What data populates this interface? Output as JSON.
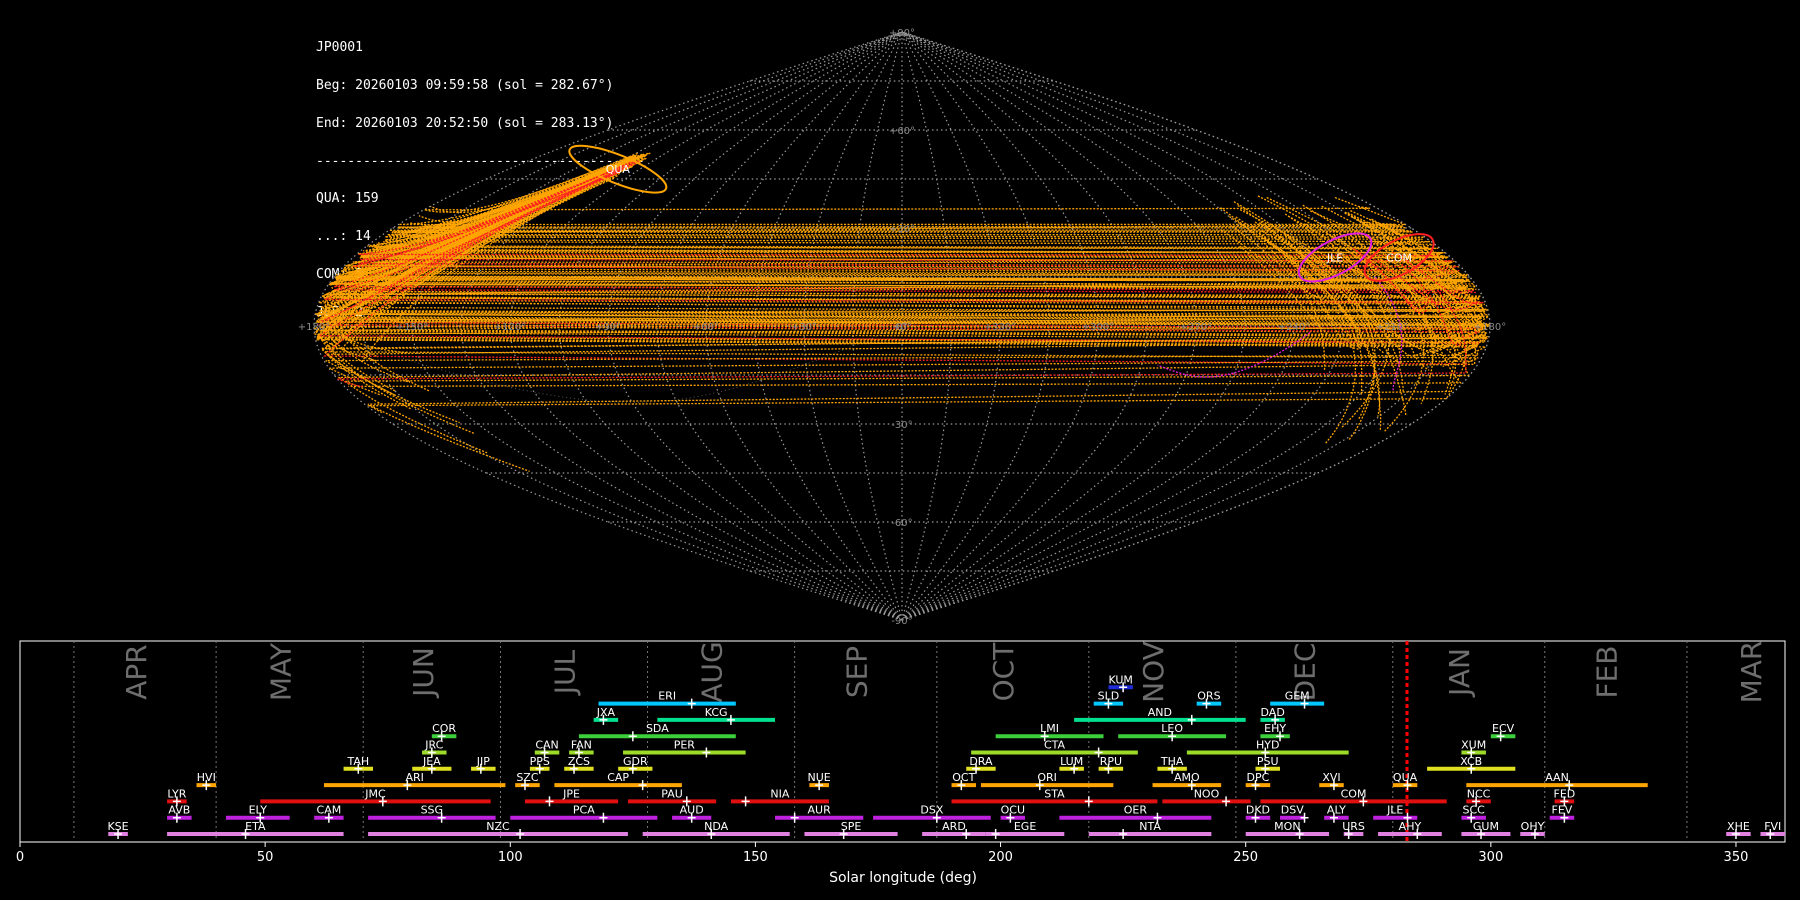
{
  "info": {
    "station": "JP0001",
    "beg": "Beg: 20260103 09:59:58 (sol = 282.67°)",
    "end": "End: 20260103 20:52:50 (sol = 283.13°)",
    "separator": "------------------------------------------",
    "counts": [
      "QUA: 159",
      "...: 14",
      "COM: 5",
      "JLE: 2"
    ]
  },
  "sky_map": {
    "projection": "sinusoidal",
    "lat_labels": [
      "+90°",
      "+60°",
      "+30°",
      "0°",
      "-30°",
      "-60°",
      "-90°"
    ],
    "lon_labels": [
      "+180°",
      "+150°",
      "+120°",
      "+90°",
      "+60°",
      "+30°",
      "+0°",
      "+330°",
      "+300°",
      "+270°",
      "+240°",
      "+210°",
      "+180°"
    ],
    "radiant_labels": [
      {
        "name": "QUA",
        "lon": 230,
        "lat": 48,
        "color": "#ff2020"
      },
      {
        "name": "COM",
        "lon": 163,
        "lat": 21,
        "color": "#ff2020"
      },
      {
        "name": "JLE",
        "lon": 142,
        "lat": 21,
        "color": "#e020e0"
      }
    ],
    "colors": {
      "sporadic": "#ffa500",
      "QUA": "#ff2020",
      "COM": "#ff2020",
      "JLE": "#e020e0",
      "grid": "#9a9a9a"
    }
  },
  "chart_data": {
    "type": "timeline",
    "xlabel": "Solar longitude (deg)",
    "xlim": [
      0,
      360
    ],
    "xticks": [
      0,
      50,
      100,
      150,
      200,
      250,
      300,
      350
    ],
    "current_sol": 282.9,
    "months": [
      {
        "name": "APR",
        "start": 11
      },
      {
        "name": "MAY",
        "start": 40
      },
      {
        "name": "JUN",
        "start": 70
      },
      {
        "name": "JUL",
        "start": 98
      },
      {
        "name": "AUG",
        "start": 128
      },
      {
        "name": "SEP",
        "start": 158
      },
      {
        "name": "OCT",
        "start": 187
      },
      {
        "name": "NOV",
        "start": 218
      },
      {
        "name": "DEC",
        "start": 248
      },
      {
        "name": "JAN",
        "start": 280
      },
      {
        "name": "FEB",
        "start": 311
      },
      {
        "name": "MAR",
        "start": 340
      }
    ],
    "showers": [
      {
        "name": "KUM",
        "start": 222,
        "end": 227,
        "peak": 225,
        "row": 10,
        "color": "#1f2bd6"
      },
      {
        "name": "ERI",
        "start": 118,
        "end": 146,
        "peak": 137,
        "row": 9,
        "color": "#00c8ff"
      },
      {
        "name": "SLD",
        "start": 219,
        "end": 225,
        "peak": 222,
        "row": 9,
        "color": "#00c8ff"
      },
      {
        "name": "ORS",
        "start": 240,
        "end": 245,
        "peak": 242,
        "row": 9,
        "color": "#00c8ff"
      },
      {
        "name": "GEM",
        "start": 255,
        "end": 266,
        "peak": 262,
        "row": 9,
        "color": "#00c8ff"
      },
      {
        "name": "JXA",
        "start": 117,
        "end": 122,
        "peak": 119,
        "row": 8,
        "color": "#00e090"
      },
      {
        "name": "KCG",
        "start": 130,
        "end": 154,
        "peak": 145,
        "row": 8,
        "color": "#00e090"
      },
      {
        "name": "AND",
        "start": 215,
        "end": 250,
        "peak": 239,
        "row": 8,
        "color": "#00e090"
      },
      {
        "name": "DAD",
        "start": 253,
        "end": 258,
        "peak": 256,
        "row": 8,
        "color": "#00e090"
      },
      {
        "name": "COR",
        "start": 84,
        "end": 89,
        "peak": 86,
        "row": 7,
        "color": "#3cd03c"
      },
      {
        "name": "SDA",
        "start": 114,
        "end": 146,
        "peak": 125,
        "row": 7,
        "color": "#3cd03c"
      },
      {
        "name": "LMI",
        "start": 199,
        "end": 221,
        "peak": 209,
        "row": 7,
        "color": "#3cd03c"
      },
      {
        "name": "LEO",
        "start": 224,
        "end": 246,
        "peak": 235,
        "row": 7,
        "color": "#3cd03c"
      },
      {
        "name": "EHY",
        "start": 253,
        "end": 259,
        "peak": 257,
        "row": 7,
        "color": "#3cd03c"
      },
      {
        "name": "ECV",
        "start": 300,
        "end": 305,
        "peak": 302,
        "row": 7,
        "color": "#3cd03c"
      },
      {
        "name": "JRC",
        "start": 82,
        "end": 87,
        "peak": 84,
        "row": 6,
        "color": "#9cdc28"
      },
      {
        "name": "CAN",
        "start": 105,
        "end": 110,
        "peak": 107,
        "row": 6,
        "color": "#9cdc28"
      },
      {
        "name": "FAN",
        "start": 112,
        "end": 117,
        "peak": 114,
        "row": 6,
        "color": "#9cdc28"
      },
      {
        "name": "PER",
        "start": 123,
        "end": 148,
        "peak": 140,
        "row": 6,
        "color": "#9cdc28"
      },
      {
        "name": "CTA",
        "start": 194,
        "end": 228,
        "peak": 220,
        "row": 6,
        "color": "#9cdc28"
      },
      {
        "name": "HYD",
        "start": 238,
        "end": 271,
        "peak": 254,
        "row": 6,
        "color": "#9cdc28"
      },
      {
        "name": "XUM",
        "start": 294,
        "end": 299,
        "peak": 296,
        "row": 6,
        "color": "#9cdc28"
      },
      {
        "name": "TAH",
        "start": 66,
        "end": 72,
        "peak": 69,
        "row": 5,
        "color": "#e0e020"
      },
      {
        "name": "JEA",
        "start": 80,
        "end": 88,
        "peak": 84,
        "row": 5,
        "color": "#e0e020"
      },
      {
        "name": "JIP",
        "start": 92,
        "end": 97,
        "peak": 94,
        "row": 5,
        "color": "#e0e020"
      },
      {
        "name": "PPS",
        "start": 104,
        "end": 108,
        "peak": 106,
        "row": 5,
        "color": "#e0e020"
      },
      {
        "name": "ZCS",
        "start": 111,
        "end": 117,
        "peak": 113,
        "row": 5,
        "color": "#e0e020"
      },
      {
        "name": "GDR",
        "start": 122,
        "end": 129,
        "peak": 125,
        "row": 5,
        "color": "#e0e020"
      },
      {
        "name": "DRA",
        "start": 193,
        "end": 199,
        "peak": 195,
        "row": 5,
        "color": "#e0e020"
      },
      {
        "name": "LUM",
        "start": 212,
        "end": 217,
        "peak": 215,
        "row": 5,
        "color": "#e0e020"
      },
      {
        "name": "RPU",
        "start": 220,
        "end": 225,
        "peak": 222,
        "row": 5,
        "color": "#e0e020"
      },
      {
        "name": "THA",
        "start": 232,
        "end": 238,
        "peak": 235,
        "row": 5,
        "color": "#e0e020"
      },
      {
        "name": "PSU",
        "start": 252,
        "end": 257,
        "peak": 254,
        "row": 5,
        "color": "#e0e020"
      },
      {
        "name": "XCB",
        "start": 287,
        "end": 305,
        "peak": 296,
        "row": 5,
        "color": "#e0e020"
      },
      {
        "name": "HVI",
        "start": 36,
        "end": 40,
        "peak": 38,
        "row": 4,
        "color": "#ffa500"
      },
      {
        "name": "ARI",
        "start": 62,
        "end": 99,
        "peak": 79,
        "row": 4,
        "color": "#ffa500"
      },
      {
        "name": "SZC",
        "start": 101,
        "end": 106,
        "peak": 103,
        "row": 4,
        "color": "#ffa500"
      },
      {
        "name": "CAP",
        "start": 109,
        "end": 135,
        "peak": 127,
        "row": 4,
        "color": "#ffa500"
      },
      {
        "name": "NUE",
        "start": 161,
        "end": 165,
        "peak": 163,
        "row": 4,
        "color": "#ffa500"
      },
      {
        "name": "OCT",
        "start": 190,
        "end": 195,
        "peak": 192,
        "row": 4,
        "color": "#ffa500"
      },
      {
        "name": "ORI",
        "start": 196,
        "end": 223,
        "peak": 208,
        "row": 4,
        "color": "#ffa500"
      },
      {
        "name": "AMO",
        "start": 231,
        "end": 245,
        "peak": 239,
        "row": 4,
        "color": "#ffa500"
      },
      {
        "name": "DPC",
        "start": 250,
        "end": 255,
        "peak": 252,
        "row": 4,
        "color": "#ffa500"
      },
      {
        "name": "XVI",
        "start": 265,
        "end": 270,
        "peak": 268,
        "row": 4,
        "color": "#ffa500"
      },
      {
        "name": "QUA",
        "start": 280,
        "end": 285,
        "peak": 283,
        "row": 4,
        "color": "#ffa500"
      },
      {
        "name": "AAN",
        "start": 295,
        "end": 332,
        "peak": 316,
        "row": 4,
        "color": "#ffa500"
      },
      {
        "name": "LYR",
        "start": 30,
        "end": 34,
        "peak": 32,
        "row": 3,
        "color": "#e01010"
      },
      {
        "name": "JMC",
        "start": 49,
        "end": 96,
        "peak": 74,
        "row": 3,
        "color": "#e01010"
      },
      {
        "name": "JPE",
        "start": 103,
        "end": 122,
        "peak": 108,
        "row": 3,
        "color": "#e01010"
      },
      {
        "name": "PAU",
        "start": 124,
        "end": 142,
        "peak": 136,
        "row": 3,
        "color": "#e01010"
      },
      {
        "name": "NIA",
        "start": 145,
        "end": 165,
        "peak": 148,
        "row": 3,
        "color": "#e01010"
      },
      {
        "name": "STA",
        "start": 190,
        "end": 232,
        "peak": 218,
        "row": 3,
        "color": "#e01010"
      },
      {
        "name": "NOO",
        "start": 233,
        "end": 251,
        "peak": 246,
        "row": 3,
        "color": "#e01010"
      },
      {
        "name": "COM",
        "start": 253,
        "end": 291,
        "peak": 274,
        "row": 3,
        "color": "#e01010"
      },
      {
        "name": "NCC",
        "start": 295,
        "end": 300,
        "peak": 297,
        "row": 3,
        "color": "#e01010"
      },
      {
        "name": "FED",
        "start": 313,
        "end": 317,
        "peak": 315,
        "row": 3,
        "color": "#e01010"
      },
      {
        "name": "AVB",
        "start": 30,
        "end": 35,
        "peak": 32,
        "row": 2,
        "color": "#c020e0"
      },
      {
        "name": "ELY",
        "start": 42,
        "end": 55,
        "peak": 49,
        "row": 2,
        "color": "#c020e0"
      },
      {
        "name": "CAM",
        "start": 60,
        "end": 66,
        "peak": 63,
        "row": 2,
        "color": "#c020e0"
      },
      {
        "name": "SSG",
        "start": 71,
        "end": 97,
        "peak": 86,
        "row": 2,
        "color": "#c020e0"
      },
      {
        "name": "PCA",
        "start": 100,
        "end": 130,
        "peak": 119,
        "row": 2,
        "color": "#c020e0"
      },
      {
        "name": "AUD",
        "start": 133,
        "end": 141,
        "peak": 137,
        "row": 2,
        "color": "#c020e0"
      },
      {
        "name": "AUR",
        "start": 154,
        "end": 172,
        "peak": 158,
        "row": 2,
        "color": "#c020e0"
      },
      {
        "name": "DSX",
        "start": 174,
        "end": 198,
        "peak": 187,
        "row": 2,
        "color": "#c020e0"
      },
      {
        "name": "OCU",
        "start": 200,
        "end": 205,
        "peak": 202,
        "row": 2,
        "color": "#c020e0"
      },
      {
        "name": "OER",
        "start": 212,
        "end": 243,
        "peak": 232,
        "row": 2,
        "color": "#c020e0"
      },
      {
        "name": "DKD",
        "start": 250,
        "end": 255,
        "peak": 252,
        "row": 2,
        "color": "#c020e0"
      },
      {
        "name": "DSV",
        "start": 257,
        "end": 262,
        "peak": 262,
        "row": 2,
        "color": "#c020e0"
      },
      {
        "name": "ALY",
        "start": 266,
        "end": 271,
        "peak": 268,
        "row": 2,
        "color": "#c020e0"
      },
      {
        "name": "JLE",
        "start": 276,
        "end": 285,
        "peak": 283,
        "row": 2,
        "color": "#c020e0"
      },
      {
        "name": "SCC",
        "start": 294,
        "end": 299,
        "peak": 296,
        "row": 2,
        "color": "#c020e0"
      },
      {
        "name": "FEV",
        "start": 312,
        "end": 317,
        "peak": 315,
        "row": 2,
        "color": "#c020e0"
      },
      {
        "name": "KSE",
        "start": 18,
        "end": 22,
        "peak": 20,
        "row": 1,
        "color": "#e080e0"
      },
      {
        "name": "ETA",
        "start": 30,
        "end": 66,
        "peak": 46,
        "row": 1,
        "color": "#e080e0"
      },
      {
        "name": "NZC",
        "start": 71,
        "end": 124,
        "peak": 102,
        "row": 1,
        "color": "#e080e0"
      },
      {
        "name": "NDA",
        "start": 127,
        "end": 157,
        "peak": 141,
        "row": 1,
        "color": "#e080e0"
      },
      {
        "name": "SPE",
        "start": 160,
        "end": 179,
        "peak": 168,
        "row": 1,
        "color": "#e080e0"
      },
      {
        "name": "ARD",
        "start": 184,
        "end": 197,
        "peak": 193,
        "row": 1,
        "color": "#e080e0"
      },
      {
        "name": "EGE",
        "start": 197,
        "end": 213,
        "peak": 199,
        "row": 1,
        "color": "#e080e0"
      },
      {
        "name": "NTA",
        "start": 218,
        "end": 243,
        "peak": 225,
        "row": 1,
        "color": "#e080e0"
      },
      {
        "name": "MON",
        "start": 250,
        "end": 267,
        "peak": 261,
        "row": 1,
        "color": "#e080e0"
      },
      {
        "name": "URS",
        "start": 270,
        "end": 274,
        "peak": 271,
        "row": 1,
        "color": "#e080e0"
      },
      {
        "name": "AHY",
        "start": 277,
        "end": 290,
        "peak": 285,
        "row": 1,
        "color": "#e080e0"
      },
      {
        "name": "GUM",
        "start": 294,
        "end": 304,
        "peak": 298,
        "row": 1,
        "color": "#e080e0"
      },
      {
        "name": "OHY",
        "start": 306,
        "end": 311,
        "peak": 309,
        "row": 1,
        "color": "#e080e0"
      },
      {
        "name": "XHE",
        "start": 348,
        "end": 353,
        "peak": 350,
        "row": 1,
        "color": "#e080e0"
      },
      {
        "name": "FVI",
        "start": 355,
        "end": 360,
        "peak": 357,
        "row": 1,
        "color": "#e080e0"
      }
    ]
  }
}
